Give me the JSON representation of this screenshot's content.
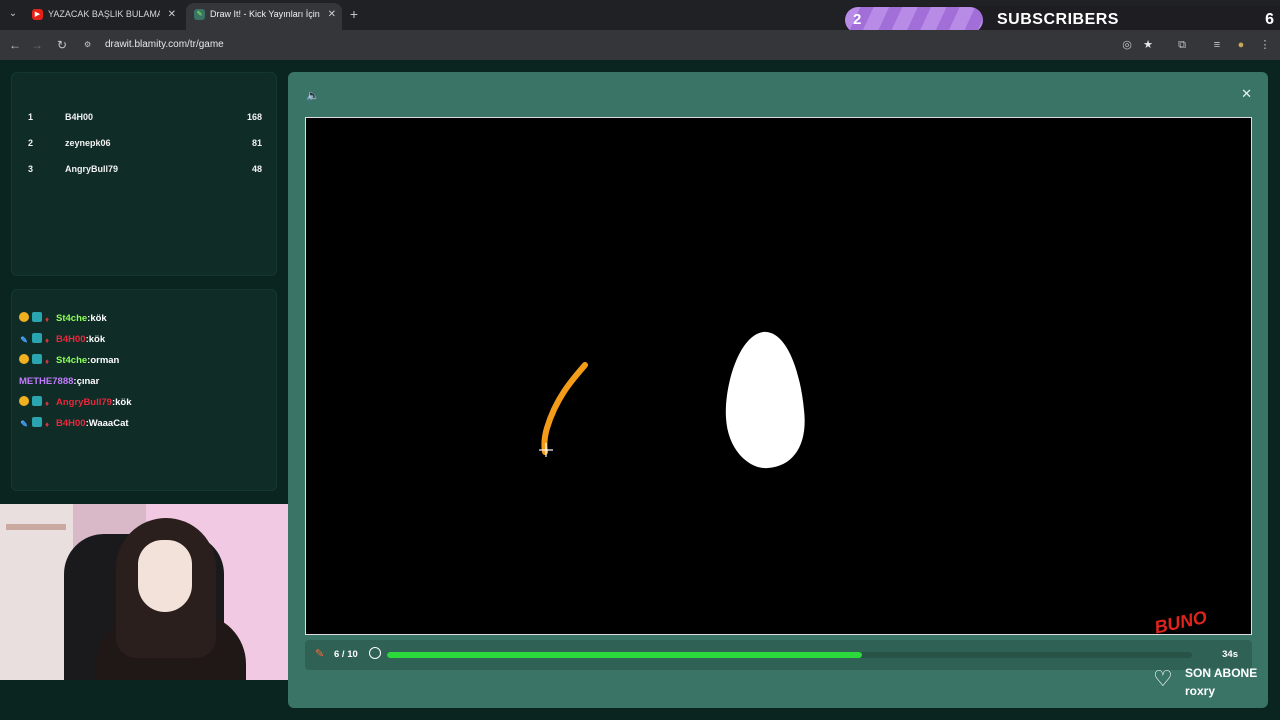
{
  "browser": {
    "tabs": [
      {
        "title": "YAZACAK BAŞLIK BULAMADIM",
        "favicon": "youtube-icon",
        "active": false
      },
      {
        "title": "Draw It! - Kick Yayınları İçin Çizim Oyunu",
        "favicon": "drawit-icon",
        "active": true
      }
    ],
    "url": "drawit.blamity.com/tr/game"
  },
  "subscriber_goal": {
    "count": "2",
    "label": "SUBSCRIBERS",
    "target": "6",
    "accent": "#b88be6"
  },
  "leaderboard": [
    {
      "rank": "1",
      "name": "B4H00",
      "score": "168"
    },
    {
      "rank": "2",
      "name": "zeynepk06",
      "score": "81"
    },
    {
      "rank": "3",
      "name": "AngryBull79",
      "score": "48"
    }
  ],
  "chat": [
    {
      "user": "St4che",
      "message": "kök",
      "user_color": "#8eff5a",
      "badges": [
        "coin",
        "square",
        "red"
      ]
    },
    {
      "user": "B4H00",
      "message": "kök",
      "user_color": "#e8283c",
      "badges": [
        "pen",
        "square",
        "red"
      ]
    },
    {
      "user": "St4che",
      "message": "orman",
      "user_color": "#8eff5a",
      "badges": [
        "coin",
        "square",
        "red"
      ]
    },
    {
      "user": "METHE7888",
      "message": "çınar",
      "user_color": "#c27bff",
      "badges": []
    },
    {
      "user": "AngryBull79",
      "message": "kök",
      "user_color": "#e8283c",
      "badges": [
        "coin",
        "square",
        "red"
      ]
    },
    {
      "user": "B4H00",
      "message": "WaaaCat",
      "user_color": "#e8283c",
      "badges": [
        "pen",
        "square",
        "red"
      ]
    }
  ],
  "game": {
    "round": "6 / 10",
    "progress_fraction": 0.59,
    "seconds_left": "34s",
    "progress_color": "#2bd93c",
    "stroke_color": "#f39c1a",
    "blob_color": "#ffffff"
  },
  "last_subscriber": {
    "title": "SON ABONE",
    "name": "roxry"
  },
  "overlay_logo": {
    "text": "BUNO",
    "color": "#e0241c"
  }
}
